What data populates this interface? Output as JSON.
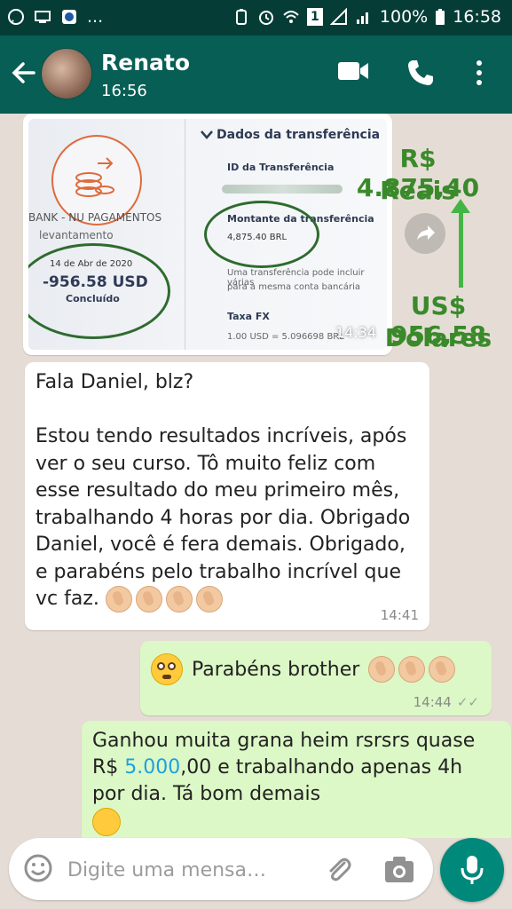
{
  "status_bar": {
    "left_icons": [
      "whatsapp-icon",
      "monitor-icon",
      "app-icon",
      "more-dots"
    ],
    "dots": "...",
    "battery": "100%",
    "time": "16:58",
    "sim": "1"
  },
  "header": {
    "contact_name": "Renato",
    "last_seen": "16:56"
  },
  "image_message": {
    "time": "14:34",
    "screenshot": {
      "bank_line1": "BANK - NU PAGAMENTOS",
      "bank_line2": "levantamento",
      "date": "14 de Abr de 2020",
      "amount": "-956.58 USD",
      "status": "Concluído",
      "details_title": "Dados da transferência",
      "id_label": "ID da Transferência",
      "amount_label": "Montante da transferência",
      "amount_value": "4,875.40 BRL",
      "note1": "Uma transferência pode incluir várias",
      "note2": "para a mesma conta bancária",
      "fx_label": "Taxa FX",
      "fx_value": "1.00 USD = 5.096698 BRL"
    }
  },
  "annotations": {
    "brl_amount": "R$ 4.875,40",
    "brl_unit": "Reais",
    "usd_amount": "US$ 956,58",
    "usd_unit": "Dólares",
    "color": "#3a8a2b"
  },
  "incoming_message": {
    "text": "Fala Daniel, blz?\n\nEstou tendo resultados incríveis, após ver o seu curso. Tô muito feliz com esse resultado do meu primeiro mês, trabalhando 4 horas por dia. Obrigado Daniel, você é fera demais. Obrigado, e parabéns pelo trabalho incrível que vc faz.",
    "time": "14:41"
  },
  "outgoing_message_1": {
    "text": "Parabéns brother",
    "time": "14:44"
  },
  "outgoing_message_2": {
    "text_before": "Ganhou muita grana heim rsrsrs quase R$ ",
    "amount": "5.000",
    "text_after": ",00 e trabalhando apenas 4h por dia. Tá bom demais"
  },
  "composer": {
    "placeholder": "Digite uma mensa…"
  },
  "colors": {
    "header": "#075e54",
    "status_bar": "#053d36",
    "outgoing_bubble": "#dcf8c6",
    "mic_button": "#00897b"
  }
}
